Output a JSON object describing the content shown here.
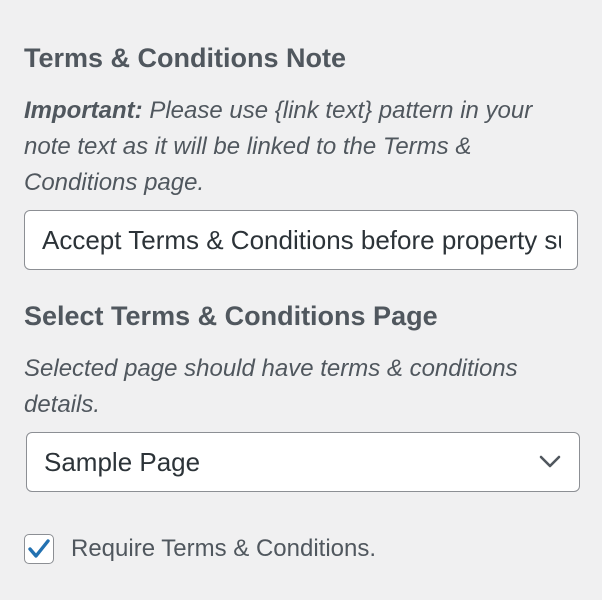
{
  "terms_note": {
    "title": "Terms & Conditions Note",
    "desc_prefix": "Important:",
    "desc_text": " Please use {link text} pattern in your note text as it will be linked to the Terms & Conditions page.",
    "input_value": "Accept Terms & Conditions before property submission."
  },
  "terms_page": {
    "title": "Select Terms & Conditions Page",
    "description": "Selected page should have terms & conditions details.",
    "selected": "Sample Page"
  },
  "require_terms": {
    "label": "Require Terms & Conditions.",
    "checked": true
  },
  "icons": {
    "dropdown": "chevron-down-icon",
    "check": "checkmark-icon"
  },
  "colors": {
    "accent": "#2271b1",
    "text": "#50575e",
    "background": "#f0f0f1",
    "border": "#8c8f94"
  }
}
